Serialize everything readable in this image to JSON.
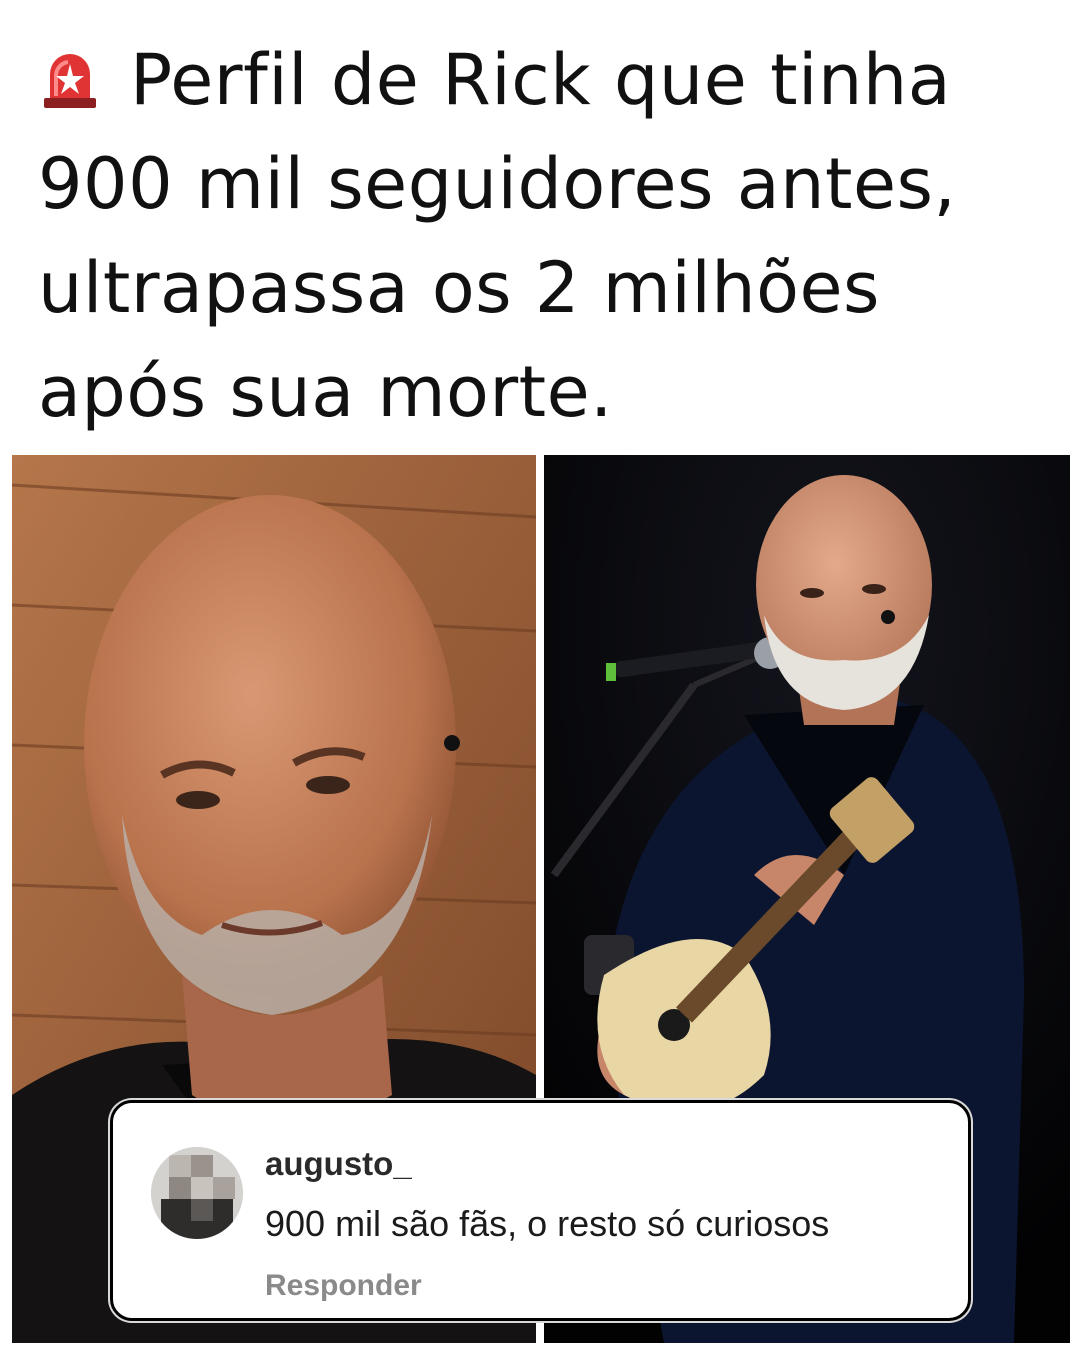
{
  "post": {
    "headline_icon": "siren-icon",
    "headline": "Perfil de Rick que tinha 900 mil seguidores antes, ultrapassa os 2 milhões após sua morte."
  },
  "photos": [
    {
      "name": "portrait-photo"
    },
    {
      "name": "concert-photo"
    }
  ],
  "comment": {
    "username": "augusto_",
    "text": "900 mil são fãs, o resto só curiosos",
    "reply_label": "Responder"
  }
}
